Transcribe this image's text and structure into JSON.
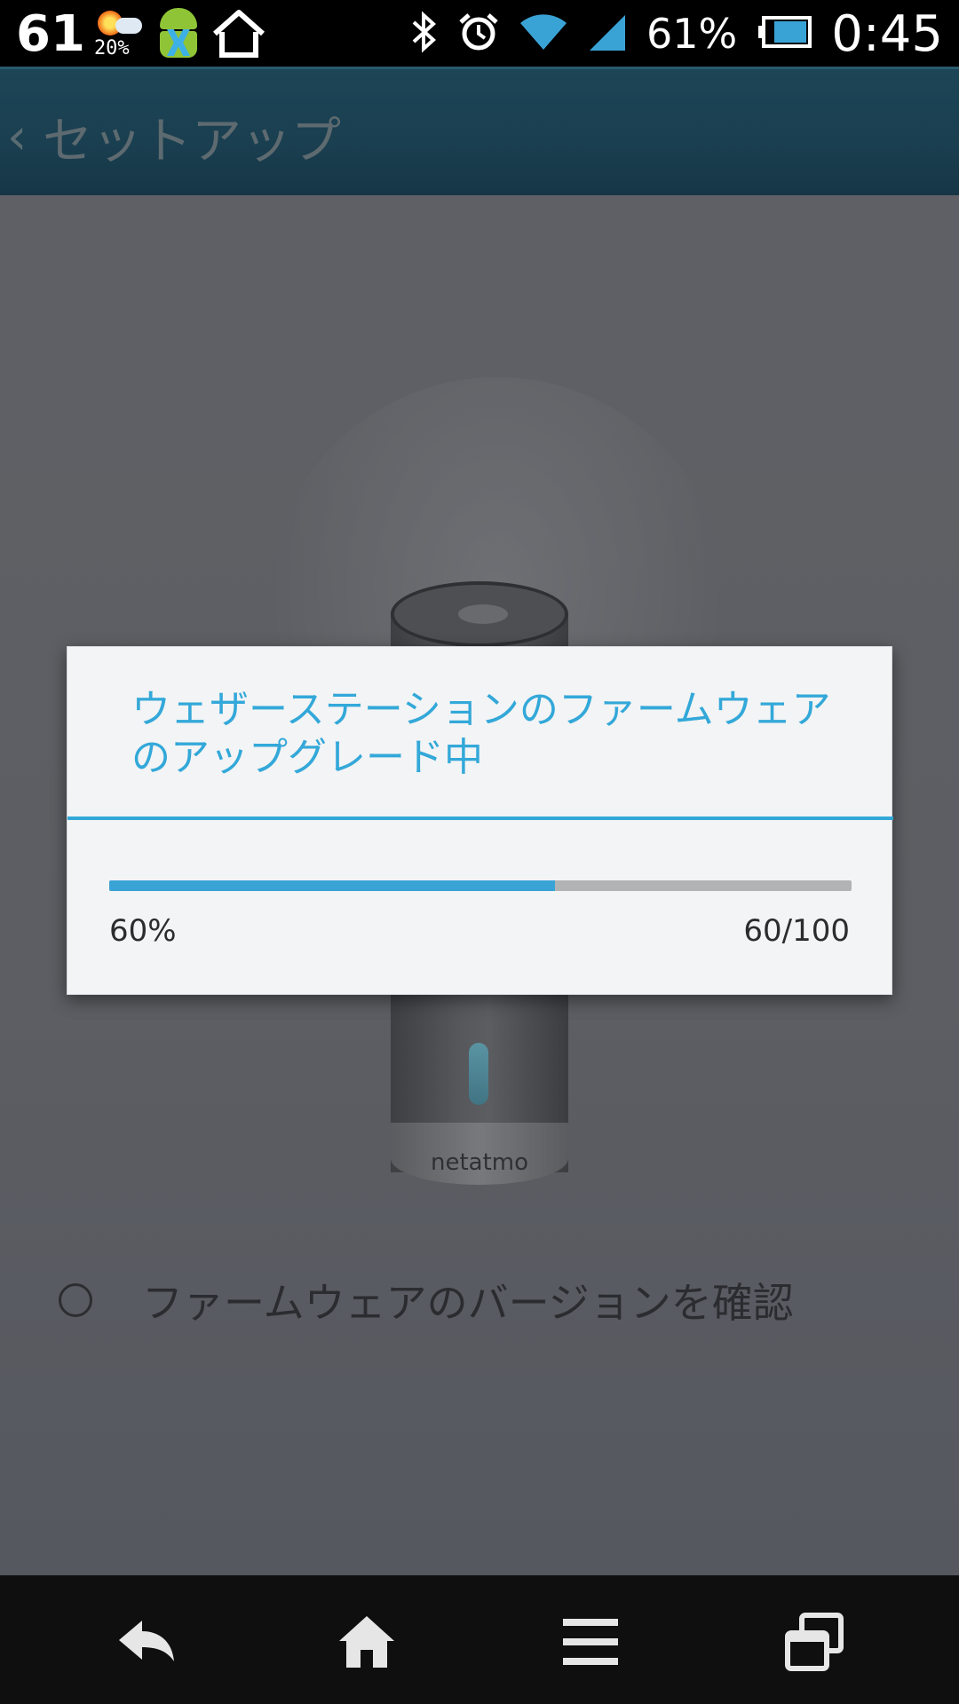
{
  "status_bar": {
    "temperature": "61",
    "weather_precip": "20%",
    "battery_percent": "61%",
    "clock": "0:45",
    "icons": [
      "weather-icon",
      "android-debug-icon",
      "home-icon",
      "bluetooth-icon",
      "alarm-icon",
      "wifi-icon",
      "signal-icon",
      "battery-icon"
    ]
  },
  "action_bar": {
    "back_glyph": "‹",
    "title": "セットアップ"
  },
  "device": {
    "brand": "netatmo"
  },
  "option": {
    "label": "ファームウェアのバージョンを確認",
    "checked": false
  },
  "dialog": {
    "title": "ウェザーステーションのファームウェアのアップグレード中",
    "progress_fraction": 0.6,
    "percent_text": "60%",
    "count_text": "60/100"
  },
  "nav_bar": {
    "buttons": [
      "back-icon",
      "home-icon",
      "menu-icon",
      "recent-apps-icon"
    ]
  },
  "colors": {
    "accent": "#33a8d9",
    "action_bar": "#1a3f50"
  }
}
